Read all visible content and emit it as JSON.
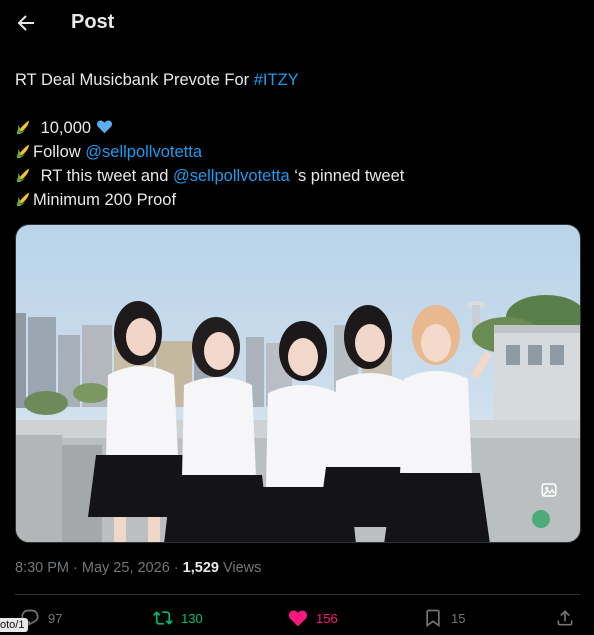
{
  "header": {
    "title": "Post"
  },
  "tweet": {
    "line1_text": "RT Deal Musicbank Prevote For ",
    "line1_hashtag": "#ITZY",
    "line2_text": " 10,000 ",
    "line3_text": "Follow ",
    "line3_mention": "@sellpollvotetta",
    "line4_text": " RT this tweet and ",
    "line4_mention": "@sellpollvotetta",
    "line4_suffix": " ‘s pinned tweet",
    "line5_text": "Minimum 200 Proof"
  },
  "meta": {
    "time": "8:30 PM",
    "separator1": " · ",
    "date": "May 25, 2026",
    "separator2": " · ",
    "views_count": "1,529",
    "views_label": " Views"
  },
  "actions": {
    "replies": "97",
    "reposts": "130",
    "likes": "156",
    "bookmarks": "15"
  },
  "side_label": "oto/1",
  "colors": {
    "background": "#000000",
    "text": "#e7e9ea",
    "secondary": "#71767b",
    "link": "#1d9bf0",
    "repost": "#00ba7c",
    "like": "#f91880",
    "divider": "#2f3336"
  },
  "icons": {
    "back": "arrow-left-icon",
    "corn": "corn-emoji-icon",
    "heart": "blue-heart-emoji-icon",
    "reply": "reply-icon",
    "repost": "repost-icon",
    "like": "heart-icon",
    "bookmark": "bookmark-icon",
    "share": "share-icon",
    "alt": "image-alt-icon"
  }
}
